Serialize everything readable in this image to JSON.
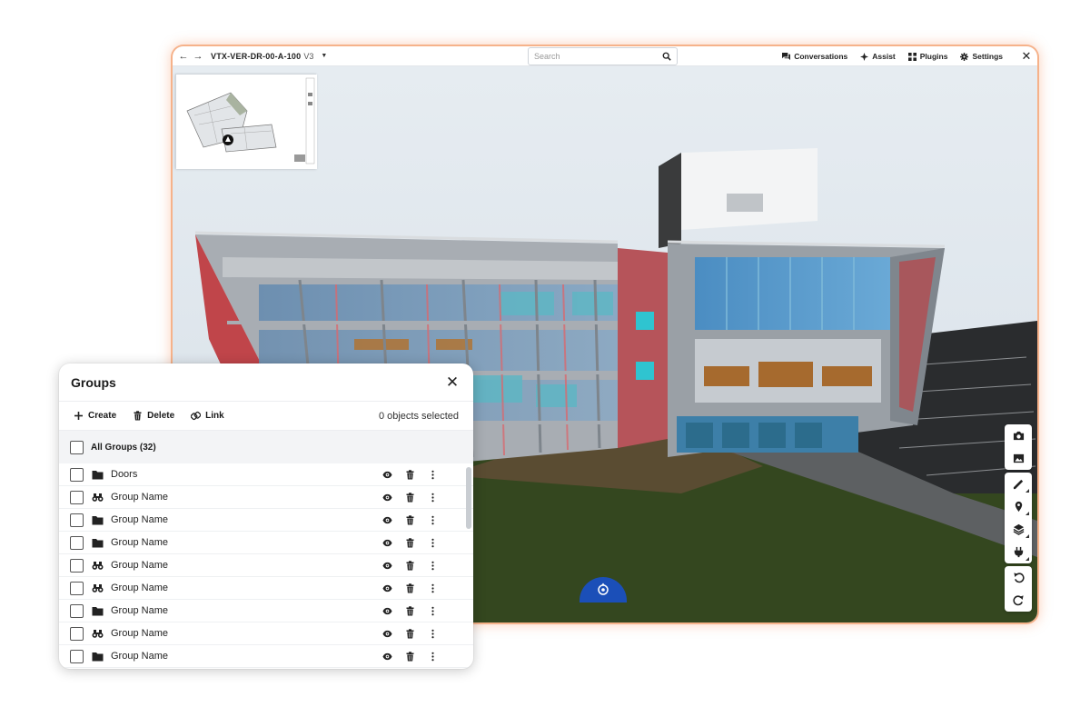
{
  "viewer": {
    "doc_title": "VTX-VER-DR-00-A-100",
    "doc_version": "V3",
    "search_placeholder": "Search",
    "actions": [
      {
        "label": "Conversations",
        "icon": "chat-icon"
      },
      {
        "label": "Assist",
        "icon": "sparkle-icon"
      },
      {
        "label": "Plugins",
        "icon": "grid-icon"
      },
      {
        "label": "Settings",
        "icon": "gear-icon"
      }
    ]
  },
  "tools": {
    "group1": [
      "camera-icon",
      "image-icon"
    ],
    "group2": [
      "measure-icon",
      "location-pin-icon",
      "layers-icon",
      "plug-icon"
    ],
    "group3": [
      "undo-icon",
      "redo-icon"
    ]
  },
  "groups": {
    "title": "Groups",
    "create_label": "Create",
    "delete_label": "Delete",
    "link_label": "Link",
    "selected_text": "0 objects selected",
    "all_label": "All Groups (32)",
    "items": [
      {
        "name": "Doors",
        "icon": "folder-icon"
      },
      {
        "name": "Group Name",
        "icon": "binoculars-icon"
      },
      {
        "name": "Group Name",
        "icon": "folder-icon"
      },
      {
        "name": "Group Name",
        "icon": "folder-icon"
      },
      {
        "name": "Group Name",
        "icon": "binoculars-icon"
      },
      {
        "name": "Group Name",
        "icon": "binoculars-icon"
      },
      {
        "name": "Group Name",
        "icon": "folder-icon"
      },
      {
        "name": "Group Name",
        "icon": "binoculars-icon"
      },
      {
        "name": "Group Name",
        "icon": "folder-icon"
      }
    ]
  },
  "colors": {
    "accent_orange": "#f07a3c",
    "compass_blue": "#1b4fb8",
    "grass": "#34471f",
    "parking": "#2a2c2e",
    "sky": "#dfe6ec"
  }
}
